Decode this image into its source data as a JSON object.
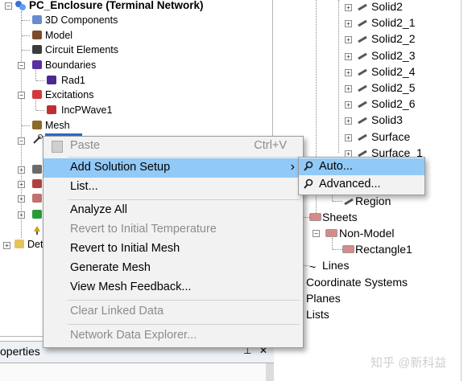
{
  "left_tree": {
    "project": "PC_Enclosure (Terminal Network)",
    "items": [
      "3D Components",
      "Model",
      "Circuit Elements",
      "Boundaries",
      "Rad1",
      "Excitations",
      "IncPWave1",
      "Mesh"
    ],
    "partial_item": "Det"
  },
  "right_tree": {
    "solids": [
      "Solid2",
      "Solid2_1",
      "Solid2_2",
      "Solid2_3",
      "Solid2_4",
      "Solid2_5",
      "Solid2_6",
      "Solid3",
      "Surface",
      "Surface_1"
    ],
    "region": "Region",
    "sheets": "Sheets",
    "non_model": "Non-Model",
    "rectangle": "Rectangle1",
    "lines": "Lines",
    "coordinate_systems": "Coordinate Systems",
    "planes": "Planes",
    "lists": "Lists"
  },
  "context_menu": {
    "paste": {
      "label": "Paste",
      "shortcut": "Ctrl+V"
    },
    "add_solution_setup": {
      "label": "Add Solution Setup",
      "arrow": "›"
    },
    "list": "List...",
    "analyze_all": "Analyze All",
    "revert_temperature": "Revert to Initial Temperature",
    "revert_mesh": "Revert to Initial Mesh",
    "generate_mesh": "Generate Mesh",
    "view_mesh_feedback": "View Mesh Feedback...",
    "clear_linked_data": "Clear Linked Data",
    "network_data_explorer": "Network Data Explorer..."
  },
  "submenu": {
    "auto": "Auto...",
    "advanced": "Advanced..."
  },
  "properties_panel": {
    "title": "operties",
    "pin": "⊥",
    "close": "✕"
  },
  "watermark": "知乎 @新科益",
  "colors": {
    "highlight": "#91c9f7",
    "menu_bg": "#f2f2f2",
    "disabled": "#8c8c8c"
  }
}
